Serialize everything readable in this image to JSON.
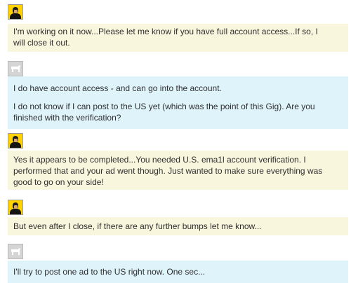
{
  "messages": [
    {
      "author": "seller",
      "avatar_icon": "seller-portrait-icon",
      "bubble_color": "#f8f6dd",
      "paragraphs": [
        [
          "I'm working on it now...Please let me know if you have full account access...If so, I",
          "will close it out."
        ]
      ]
    },
    {
      "author": "buyer",
      "avatar_icon": "default-user-silhouette-icon",
      "bubble_color": "#dff3fb",
      "paragraphs": [
        [
          "I do have account access - and can go into the account."
        ],
        [
          "I do not know if I can post to the US yet (which was the point of this Gig). Are you",
          "finished with the verification?"
        ]
      ]
    },
    {
      "author": "seller",
      "avatar_icon": "seller-portrait-icon",
      "bubble_color": "#f8f6dd",
      "paragraphs": [
        [
          "Yes it appears to be completed...You needed U.S. ema1l account verification. I",
          "performed that and your ad went though. Just wanted to make sure everything was",
          "good to go on your side!"
        ]
      ]
    },
    {
      "author": "seller",
      "avatar_icon": "seller-portrait-icon",
      "bubble_color": "#f8f6dd",
      "paragraphs": [
        [
          "But even after I close, if there are any further bumps let me know..."
        ]
      ]
    },
    {
      "author": "buyer",
      "avatar_icon": "default-user-silhouette-icon",
      "bubble_color": "#dff3fb",
      "paragraphs": [
        [
          "I'll try to post one ad to the US right now. One sec..."
        ]
      ]
    }
  ]
}
